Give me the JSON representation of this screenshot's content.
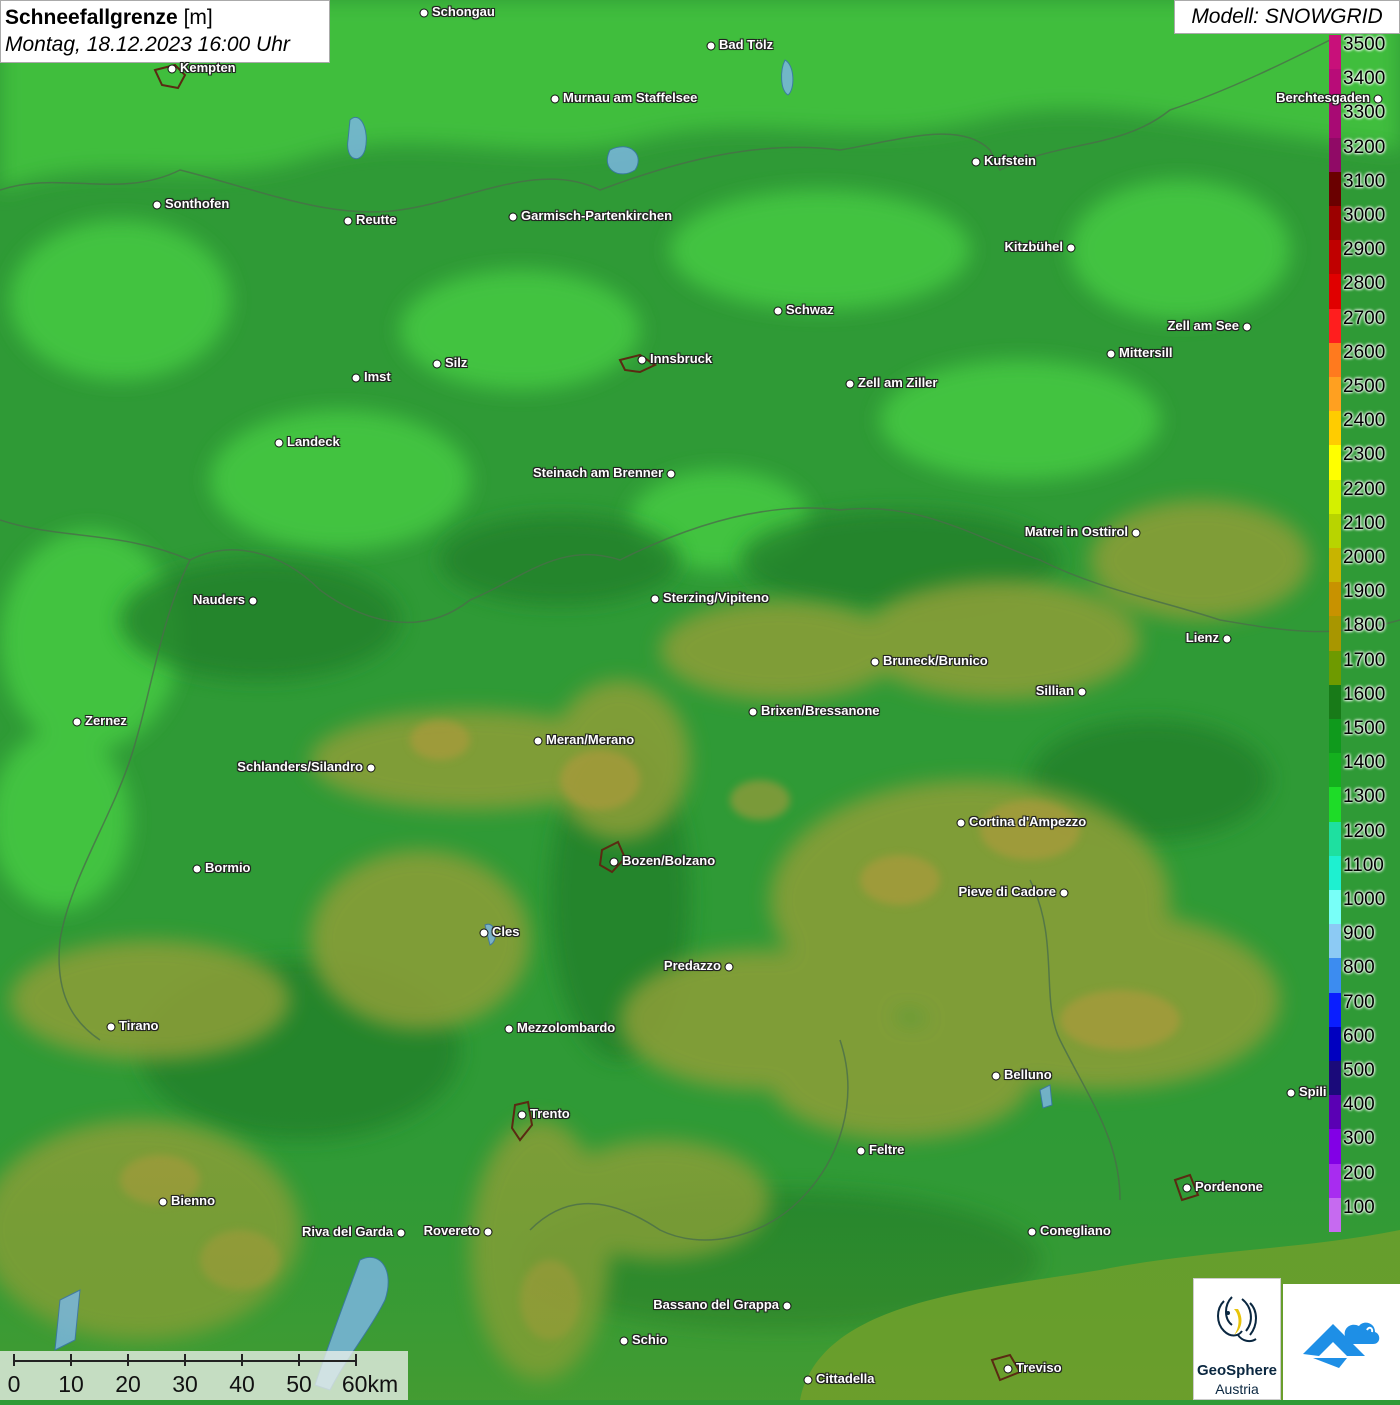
{
  "title": {
    "main": "Schneefallgrenze",
    "unit": "[m]",
    "datetime": "Montag, 18.12.2023 16:00 Uhr"
  },
  "model_label": "Modell: SNOWGRID",
  "legend": {
    "levels": [
      {
        "label": "3500",
        "color": "#c8107a"
      },
      {
        "label": "3400",
        "color": "#b80c78"
      },
      {
        "label": "3300",
        "color": "#a80a74"
      },
      {
        "label": "3200",
        "color": "#900a66"
      },
      {
        "label": "3100",
        "color": "#6a0000"
      },
      {
        "label": "3000",
        "color": "#9c0000"
      },
      {
        "label": "2900",
        "color": "#c00000"
      },
      {
        "label": "2800",
        "color": "#e00000"
      },
      {
        "label": "2700",
        "color": "#ff1e1e"
      },
      {
        "label": "2600",
        "color": "#ff7a1e"
      },
      {
        "label": "2500",
        "color": "#ffa020"
      },
      {
        "label": "2400",
        "color": "#ffcc00"
      },
      {
        "label": "2300",
        "color": "#ffff00"
      },
      {
        "label": "2200",
        "color": "#d4f000"
      },
      {
        "label": "2100",
        "color": "#b8d400"
      },
      {
        "label": "2000",
        "color": "#c8b400"
      },
      {
        "label": "1900",
        "color": "#c89200"
      },
      {
        "label": "1800",
        "color": "#a89600"
      },
      {
        "label": "1700",
        "color": "#6e9a00"
      },
      {
        "label": "1600",
        "color": "#187a18"
      },
      {
        "label": "1500",
        "color": "#0f9a1c"
      },
      {
        "label": "1400",
        "color": "#14b01e"
      },
      {
        "label": "1300",
        "color": "#1edc28"
      },
      {
        "label": "1200",
        "color": "#1ee0a0"
      },
      {
        "label": "1100",
        "color": "#1ef0d0"
      },
      {
        "label": "1000",
        "color": "#78fff8"
      },
      {
        "label": "900",
        "color": "#8ccaf4"
      },
      {
        "label": "800",
        "color": "#3c8cf0"
      },
      {
        "label": "700",
        "color": "#0a1eff"
      },
      {
        "label": "600",
        "color": "#0000c0"
      },
      {
        "label": "500",
        "color": "#1a0a7a"
      },
      {
        "label": "400",
        "color": "#5a00b4"
      },
      {
        "label": "300",
        "color": "#8200e6"
      },
      {
        "label": "200",
        "color": "#a82cf0"
      },
      {
        "label": "100",
        "color": "#c66af0"
      }
    ]
  },
  "cities": [
    {
      "name": "Schongau"
    },
    {
      "name": "Bad Tölz"
    },
    {
      "name": "Kempten"
    },
    {
      "name": "Murnau am Staffelsee"
    },
    {
      "name": "Berchtesgaden"
    },
    {
      "name": "Kufstein"
    },
    {
      "name": "Sonthofen"
    },
    {
      "name": "Reutte"
    },
    {
      "name": "Garmisch-Partenkirchen"
    },
    {
      "name": "Kitzbühel"
    },
    {
      "name": "Schwaz"
    },
    {
      "name": "Zell am See"
    },
    {
      "name": "Innsbruck"
    },
    {
      "name": "Mittersill"
    },
    {
      "name": "Imst"
    },
    {
      "name": "Silz"
    },
    {
      "name": "Zell am Ziller"
    },
    {
      "name": "Landeck"
    },
    {
      "name": "Steinach am Brenner"
    },
    {
      "name": "Matrei in Osttirol"
    },
    {
      "name": "Nauders"
    },
    {
      "name": "Sterzing/Vipiteno"
    },
    {
      "name": "Lienz"
    },
    {
      "name": "Bruneck/Brunico"
    },
    {
      "name": "Sillian"
    },
    {
      "name": "Brixen/Bressanone"
    },
    {
      "name": "Zernez"
    },
    {
      "name": "Meran/Merano"
    },
    {
      "name": "Schlanders/Silandro"
    },
    {
      "name": "Cortina d'Ampezzo"
    },
    {
      "name": "Bozen/Bolzano"
    },
    {
      "name": "Bormio"
    },
    {
      "name": "Pieve di Cadore"
    },
    {
      "name": "Cles"
    },
    {
      "name": "Predazzo"
    },
    {
      "name": "Tirano"
    },
    {
      "name": "Mezzolombardo"
    },
    {
      "name": "Belluno"
    },
    {
      "name": "Spili"
    },
    {
      "name": "Trento"
    },
    {
      "name": "Feltre"
    },
    {
      "name": "Pordenone"
    },
    {
      "name": "Bienno"
    },
    {
      "name": "Riva del Garda"
    },
    {
      "name": "Rovereto"
    },
    {
      "name": "Conegliano"
    },
    {
      "name": "Bassano del Grappa"
    },
    {
      "name": "Schio"
    },
    {
      "name": "Treviso"
    },
    {
      "name": "Cittadella"
    }
  ],
  "scale_bar": {
    "labels": [
      "0",
      "10",
      "20",
      "30",
      "40",
      "50",
      "60km"
    ]
  },
  "logos": {
    "geosphere_line1": "GeoSphere",
    "geosphere_line2": "Austria"
  }
}
